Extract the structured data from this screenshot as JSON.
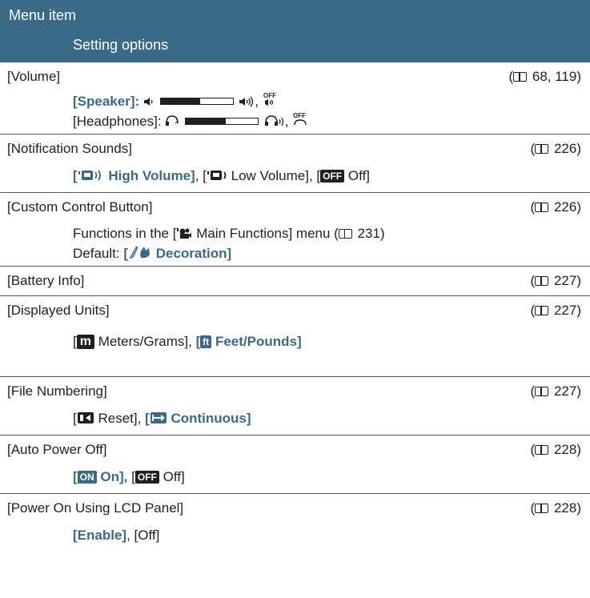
{
  "header": {
    "col1": "Menu item",
    "col2": "Setting options"
  },
  "rows": [
    {
      "title": "[Volume]",
      "ref": "68, 119",
      "speaker_label": "[Speaker]:",
      "speaker_level": 0.55,
      "headphones_label": "[Headphones]:",
      "headphones_level": 0.55,
      "comma": ","
    },
    {
      "title": "[Notification Sounds]",
      "ref": "226",
      "opt1": "High Volume]",
      "opt2": "Low Volume],",
      "opt3": "Off]"
    },
    {
      "title": "[Custom Control Button]",
      "ref": "226",
      "line1_a": "Functions in the [",
      "line1_b": "Main Functions] menu (",
      "line1_ref": "231)",
      "default_label": "Default:",
      "default_value": "Decoration]"
    },
    {
      "title": "[Battery Info]",
      "ref": "227"
    },
    {
      "title": "[Displayed Units]",
      "ref": "227",
      "opt1_icon": "m",
      "opt1": "Meters/Grams],",
      "opt2_icon": "ft",
      "opt2": "Feet/Pounds]"
    },
    {
      "title": "[File Numbering]",
      "ref": "227",
      "opt1": "Reset],",
      "opt2": "Continuous]"
    },
    {
      "title": "[Auto Power Off]",
      "ref": "228",
      "opt1_icon": "ON",
      "opt1": "On],",
      "opt2_icon": "OFF",
      "opt2": "Off]"
    },
    {
      "title": "[Power On Using LCD Panel]",
      "ref": "228",
      "opt1": "[Enable]",
      "opt2": ", [Off]"
    }
  ],
  "icons": {
    "book": "book-reference-icon",
    "speaker": "speaker-icon",
    "headphones": "headphones-icon",
    "off": "off-icon",
    "movie": "movie-camera-icon",
    "decoration": "decoration-icon",
    "reset": "reset-icon",
    "continuous": "continuous-icon"
  },
  "colors": {
    "accent": "#3a6a86",
    "text": "#231f20",
    "rule": "#555555"
  }
}
